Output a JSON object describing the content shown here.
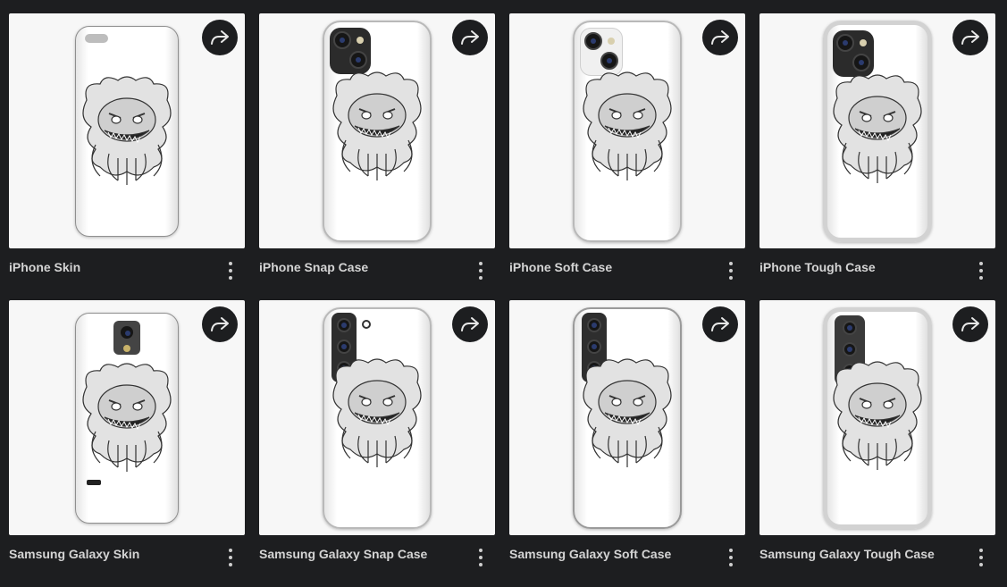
{
  "products": [
    {
      "title": "iPhone Skin",
      "variant": "iphone-skin"
    },
    {
      "title": "iPhone Snap Case",
      "variant": "iphone-snap"
    },
    {
      "title": "iPhone Soft Case",
      "variant": "iphone-soft"
    },
    {
      "title": "iPhone Tough Case",
      "variant": "iphone-tough"
    },
    {
      "title": "Samsung Galaxy Skin",
      "variant": "galaxy-skin"
    },
    {
      "title": "Samsung Galaxy Snap Case",
      "variant": "galaxy-snap"
    },
    {
      "title": "Samsung Galaxy Soft Case",
      "variant": "galaxy-soft"
    },
    {
      "title": "Samsung Galaxy Tough Case",
      "variant": "galaxy-tough"
    }
  ],
  "icons": {
    "share": "share-arrow-icon",
    "more": "more-vertical-icon"
  },
  "colors": {
    "background": "#1d1e20",
    "card": "#f7f7f7",
    "text": "#d4d4d4"
  }
}
